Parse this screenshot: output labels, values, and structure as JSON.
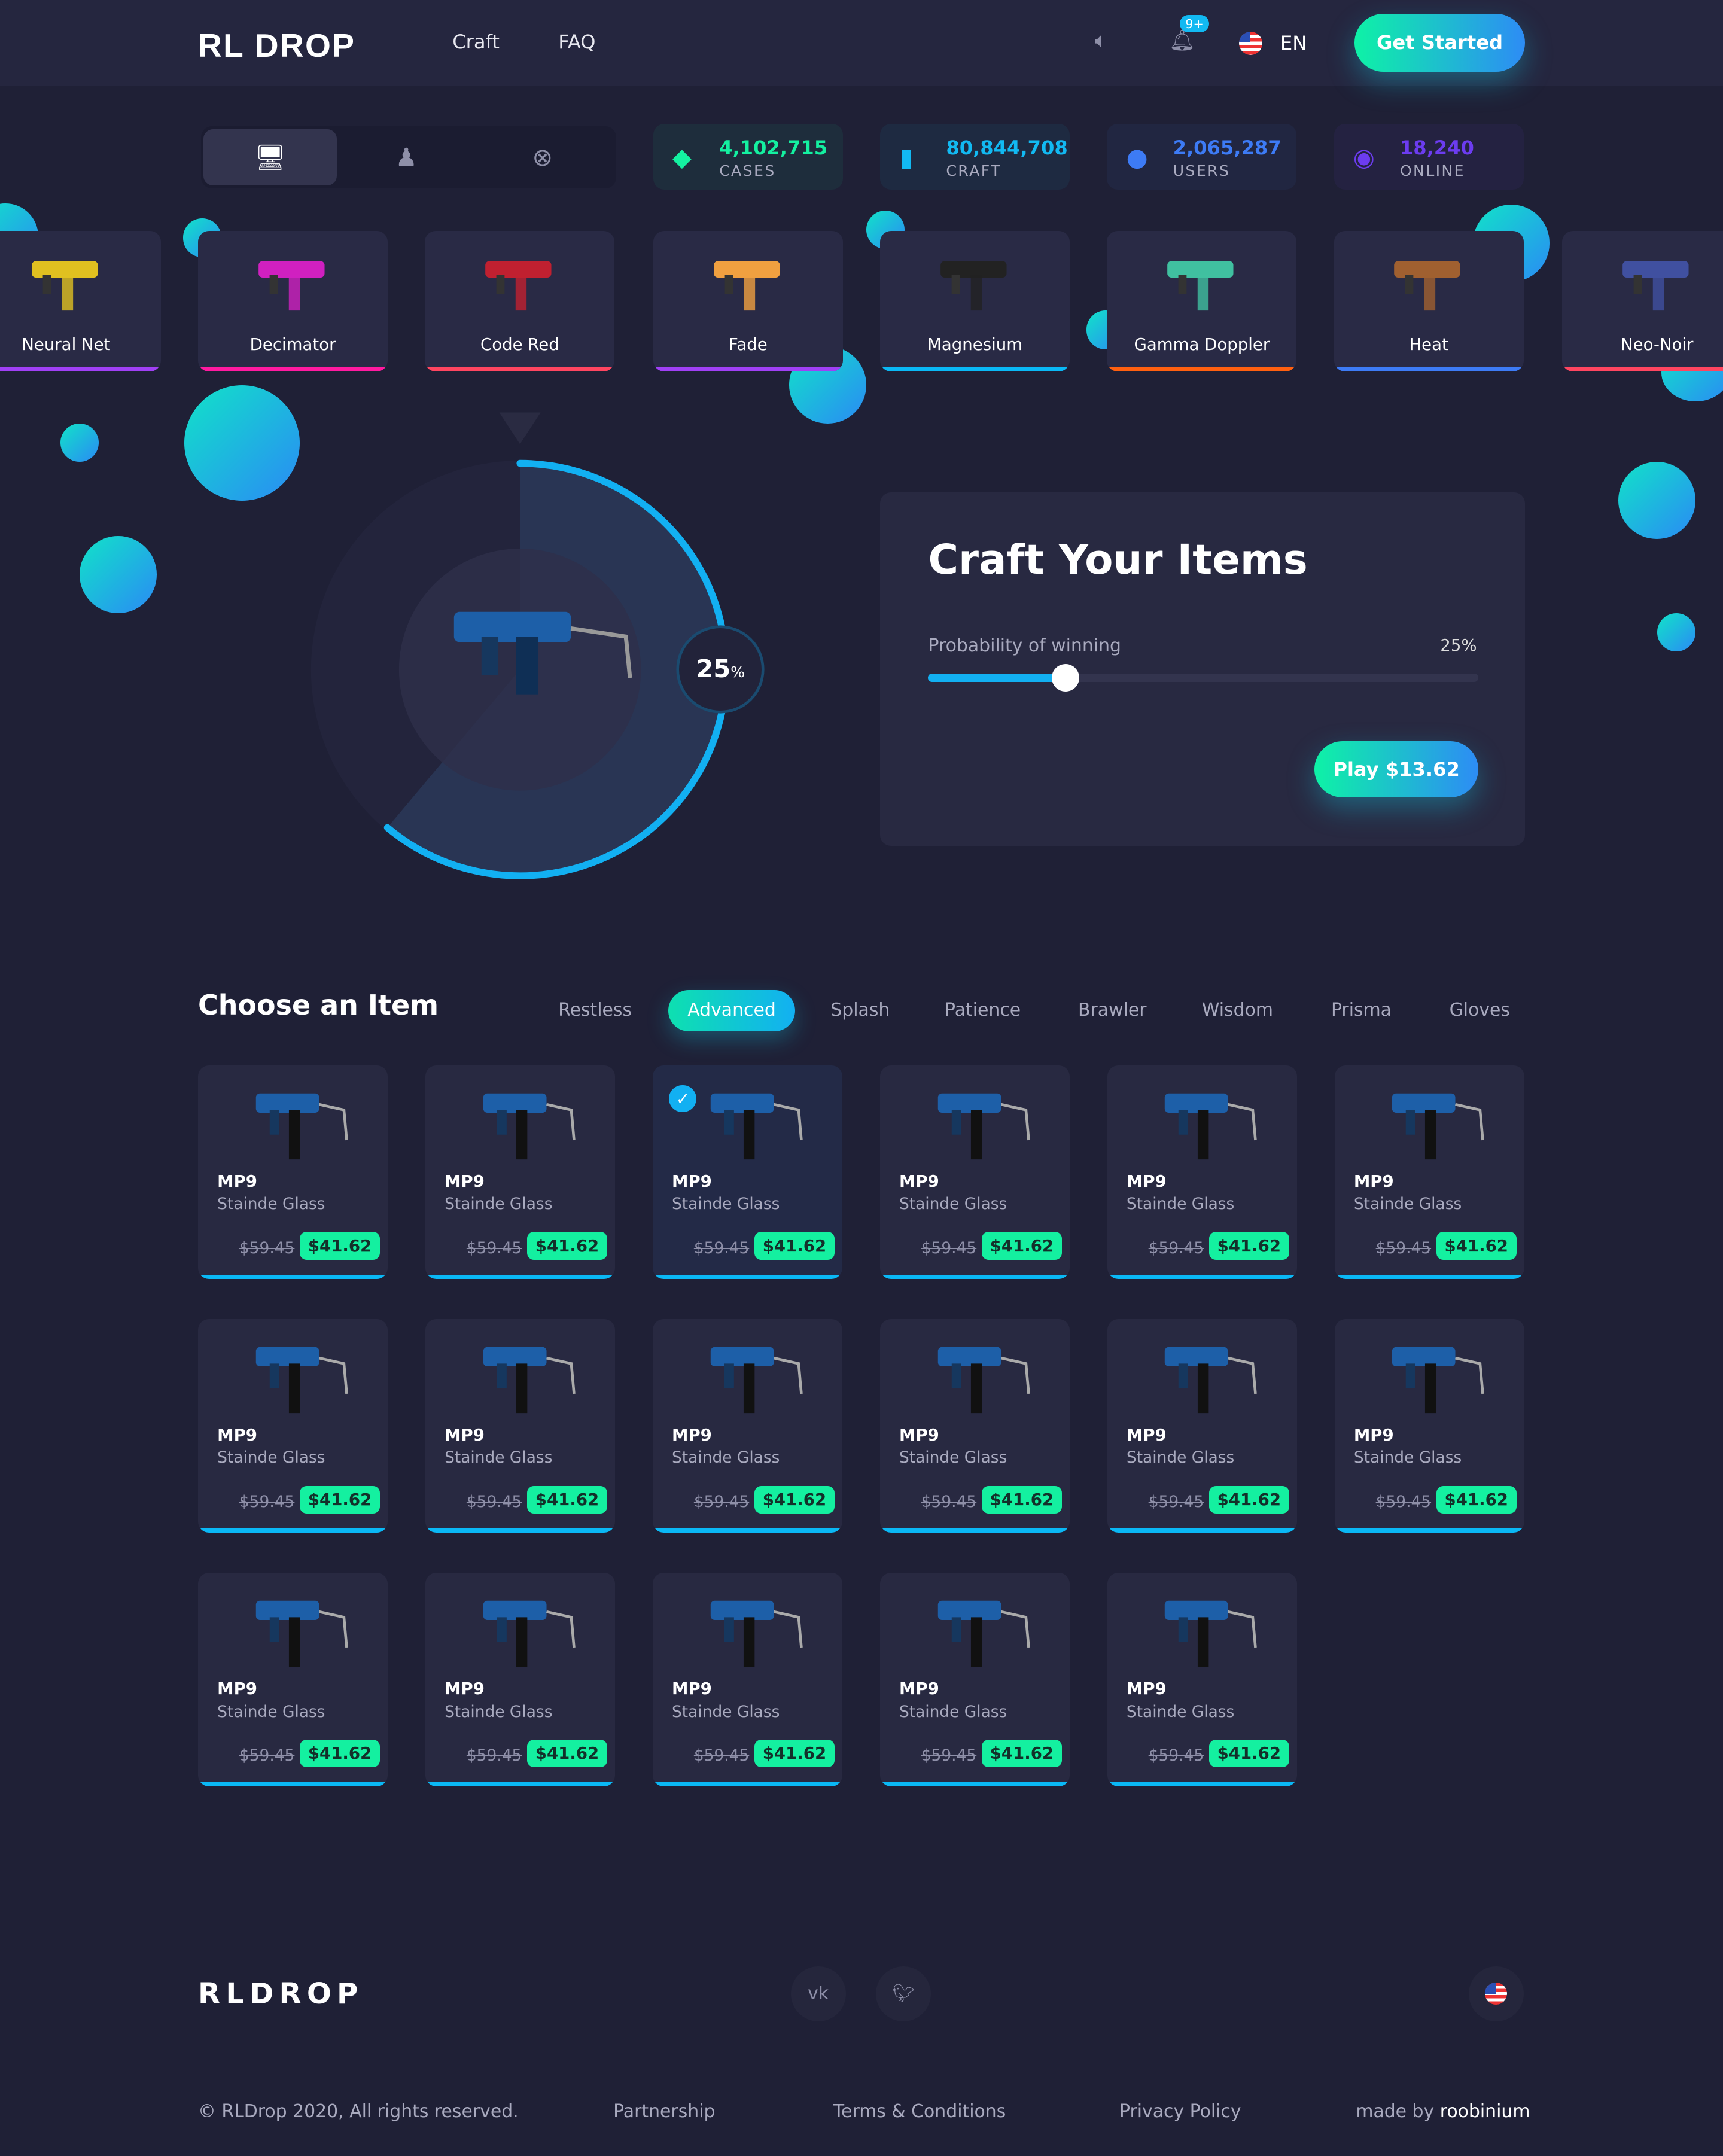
{
  "header": {
    "logo": "RL DROP",
    "nav": [
      "Craft",
      "FAQ"
    ],
    "notification_count": "9+",
    "language": "EN",
    "cta": "Get Started"
  },
  "platforms": [
    {
      "icon": "desktop-icon",
      "active": true
    },
    {
      "icon": "playstation-icon",
      "active": false
    },
    {
      "icon": "xbox-icon",
      "active": false
    }
  ],
  "stats": [
    {
      "value": "4,102,715",
      "label": "CASES",
      "icon": "layers-icon",
      "color": "#14f0a0"
    },
    {
      "value": "80,844,708",
      "label": "CRAFT",
      "icon": "chart-icon",
      "color": "#12b9f2"
    },
    {
      "value": "2,065,287",
      "label": "USERS",
      "icon": "user-icon",
      "color": "#3d7bf5"
    },
    {
      "value": "18,240",
      "label": "ONLINE",
      "icon": "wifi-icon",
      "color": "#6c3cf0"
    }
  ],
  "featured": [
    {
      "name": "Neural Net",
      "color": "#a040f5",
      "gun": "#e0c020"
    },
    {
      "name": "Decimator",
      "color": "#ff1aa0",
      "gun": "#d020c0"
    },
    {
      "name": "Code Red",
      "color": "#ff4560",
      "gun": "#c02030"
    },
    {
      "name": "Fade",
      "color": "#a040f5",
      "gun": "#f0a040"
    },
    {
      "name": "Magnesium",
      "color": "#0ab8f5",
      "gun": "#222"
    },
    {
      "name": "Gamma Doppler",
      "color": "#ff6010",
      "gun": "#40c0a0"
    },
    {
      "name": "Heat",
      "color": "#3d7bf5",
      "gun": "#a06030"
    },
    {
      "name": "Neo-Noir",
      "color": "#ff4560",
      "gun": "#4050a0"
    }
  ],
  "craft": {
    "percent": "25",
    "percent_unit": "%",
    "title": "Craft Your Items",
    "probability_label": "Probability of winning",
    "probability_value": "25%",
    "probability": 0.25,
    "play": "Play $13.62"
  },
  "choose": {
    "title": "Choose an Item",
    "tabs": [
      "Restless",
      "Advanced",
      "Splash",
      "Patience",
      "Brawler",
      "Wisdom",
      "Prisma",
      "Gloves"
    ],
    "active_tab": 1
  },
  "items": [
    {
      "name": "MP9",
      "skin": "Stainde Glass",
      "old": "$59.45",
      "price": "$41.62"
    },
    {
      "name": "MP9",
      "skin": "Stainde Glass",
      "old": "$59.45",
      "price": "$41.62"
    },
    {
      "name": "MP9",
      "skin": "Stainde Glass",
      "old": "$59.45",
      "price": "$41.62",
      "selected": true
    },
    {
      "name": "MP9",
      "skin": "Stainde Glass",
      "old": "$59.45",
      "price": "$41.62"
    },
    {
      "name": "MP9",
      "skin": "Stainde Glass",
      "old": "$59.45",
      "price": "$41.62"
    },
    {
      "name": "MP9",
      "skin": "Stainde Glass",
      "old": "$59.45",
      "price": "$41.62"
    },
    {
      "name": "MP9",
      "skin": "Stainde Glass",
      "old": "$59.45",
      "price": "$41.62"
    },
    {
      "name": "MP9",
      "skin": "Stainde Glass",
      "old": "$59.45",
      "price": "$41.62"
    },
    {
      "name": "MP9",
      "skin": "Stainde Glass",
      "old": "$59.45",
      "price": "$41.62"
    },
    {
      "name": "MP9",
      "skin": "Stainde Glass",
      "old": "$59.45",
      "price": "$41.62"
    },
    {
      "name": "MP9",
      "skin": "Stainde Glass",
      "old": "$59.45",
      "price": "$41.62"
    },
    {
      "name": "MP9",
      "skin": "Stainde Glass",
      "old": "$59.45",
      "price": "$41.62"
    },
    {
      "name": "MP9",
      "skin": "Stainde Glass",
      "old": "$59.45",
      "price": "$41.62"
    },
    {
      "name": "MP9",
      "skin": "Stainde Glass",
      "old": "$59.45",
      "price": "$41.62"
    },
    {
      "name": "MP9",
      "skin": "Stainde Glass",
      "old": "$59.45",
      "price": "$41.62"
    },
    {
      "name": "MP9",
      "skin": "Stainde Glass",
      "old": "$59.45",
      "price": "$41.62"
    },
    {
      "name": "MP9",
      "skin": "Stainde Glass",
      "old": "$59.45",
      "price": "$41.62"
    }
  ],
  "footer": {
    "brand": "RLDROP",
    "social": [
      "vk-icon",
      "twitter-icon"
    ],
    "copyright": "© RLDrop 2020, All rights reserved.",
    "links": [
      "Partnership",
      "Terms & Conditions",
      "Privacy Policy"
    ],
    "made_by_prefix": "made by",
    "made_by": "roobinium"
  }
}
